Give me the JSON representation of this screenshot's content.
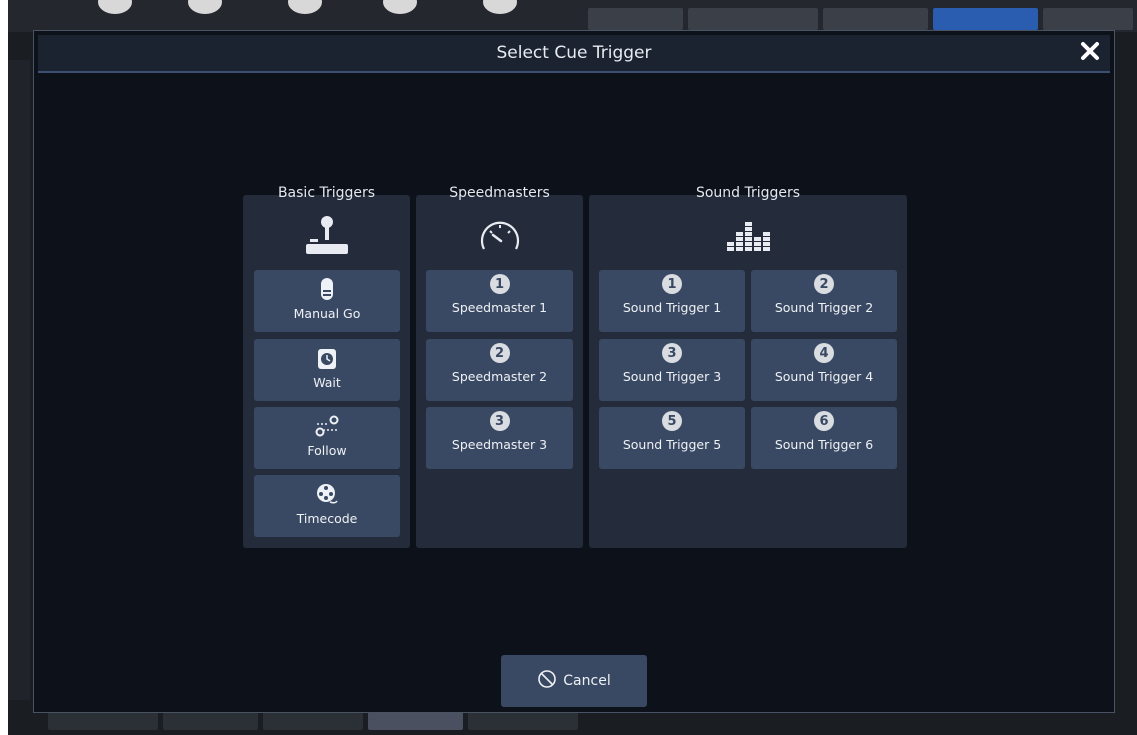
{
  "dialog": {
    "title": "Select Cue Trigger",
    "close_icon": "close-icon",
    "cancel_label": "Cancel"
  },
  "groups": {
    "basic": {
      "title": "Basic Triggers",
      "icon": "joystick-icon",
      "buttons": [
        {
          "label": "Manual Go",
          "icon": "finger-press-icon"
        },
        {
          "label": "Wait",
          "icon": "clock-icon"
        },
        {
          "label": "Follow",
          "icon": "follow-route-icon"
        },
        {
          "label": "Timecode",
          "icon": "reel-icon"
        }
      ]
    },
    "speed": {
      "title": "Speedmasters",
      "icon": "speedometer-icon",
      "buttons": [
        {
          "num": "1",
          "label": "Speedmaster 1"
        },
        {
          "num": "2",
          "label": "Speedmaster 2"
        },
        {
          "num": "3",
          "label": "Speedmaster 3"
        }
      ]
    },
    "sound": {
      "title": "Sound Triggers",
      "icon": "equalizer-icon",
      "buttons": [
        {
          "num": "1",
          "label": "Sound Trigger 1"
        },
        {
          "num": "2",
          "label": "Sound Trigger 2"
        },
        {
          "num": "3",
          "label": "Sound Trigger 3"
        },
        {
          "num": "4",
          "label": "Sound Trigger 4"
        },
        {
          "num": "5",
          "label": "Sound Trigger 5"
        },
        {
          "num": "6",
          "label": "Sound Trigger 6"
        }
      ]
    }
  },
  "colors": {
    "dialog_bg": "#0d121a",
    "panel_bg": "#242b3a",
    "button_bg": "#3a4963",
    "header_accent": "#3c4f73"
  }
}
